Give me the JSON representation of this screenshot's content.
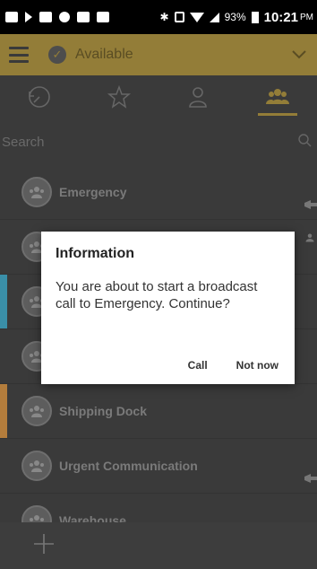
{
  "status_bar": {
    "battery": "93%",
    "time": "10:21",
    "ampm": "PM",
    "icons": [
      "message-icon",
      "play-icon",
      "gallery-icon",
      "share-icon",
      "news-icon",
      "image-icon",
      "bluetooth-icon",
      "nfc-icon",
      "wifi-icon",
      "signal-icon",
      "battery-icon"
    ]
  },
  "toolbar": {
    "status_label": "Available"
  },
  "tabs": [
    {
      "name": "recent",
      "icon": "history-icon"
    },
    {
      "name": "favorites",
      "icon": "star-icon"
    },
    {
      "name": "contacts",
      "icon": "person-icon"
    },
    {
      "name": "groups",
      "icon": "group-icon",
      "active": true
    }
  ],
  "search": {
    "placeholder": "Search"
  },
  "list": {
    "items": [
      {
        "label": "Emergency",
        "accent": "",
        "trailing_icon": "megaphone-icon"
      },
      {
        "label": "",
        "accent": "",
        "trailing_icon": "person-icon"
      },
      {
        "label": "",
        "accent": "#3a8fa8",
        "trailing_icon": ""
      },
      {
        "label": "",
        "accent": "",
        "trailing_icon": ""
      },
      {
        "label": "Shipping Dock",
        "accent": "#b47d3c",
        "trailing_icon": ""
      },
      {
        "label": "Urgent Communication",
        "accent": "",
        "trailing_icon": "megaphone-icon"
      },
      {
        "label": "Warehouse",
        "accent": "",
        "trailing_icon": ""
      }
    ]
  },
  "dialog": {
    "title": "Information",
    "message": "You are about to start a broadcast call to Emergency. Continue?",
    "call_label": "Call",
    "not_now_label": "Not now"
  },
  "colors": {
    "accent": "#937d38",
    "background": "#3a3a3a"
  }
}
